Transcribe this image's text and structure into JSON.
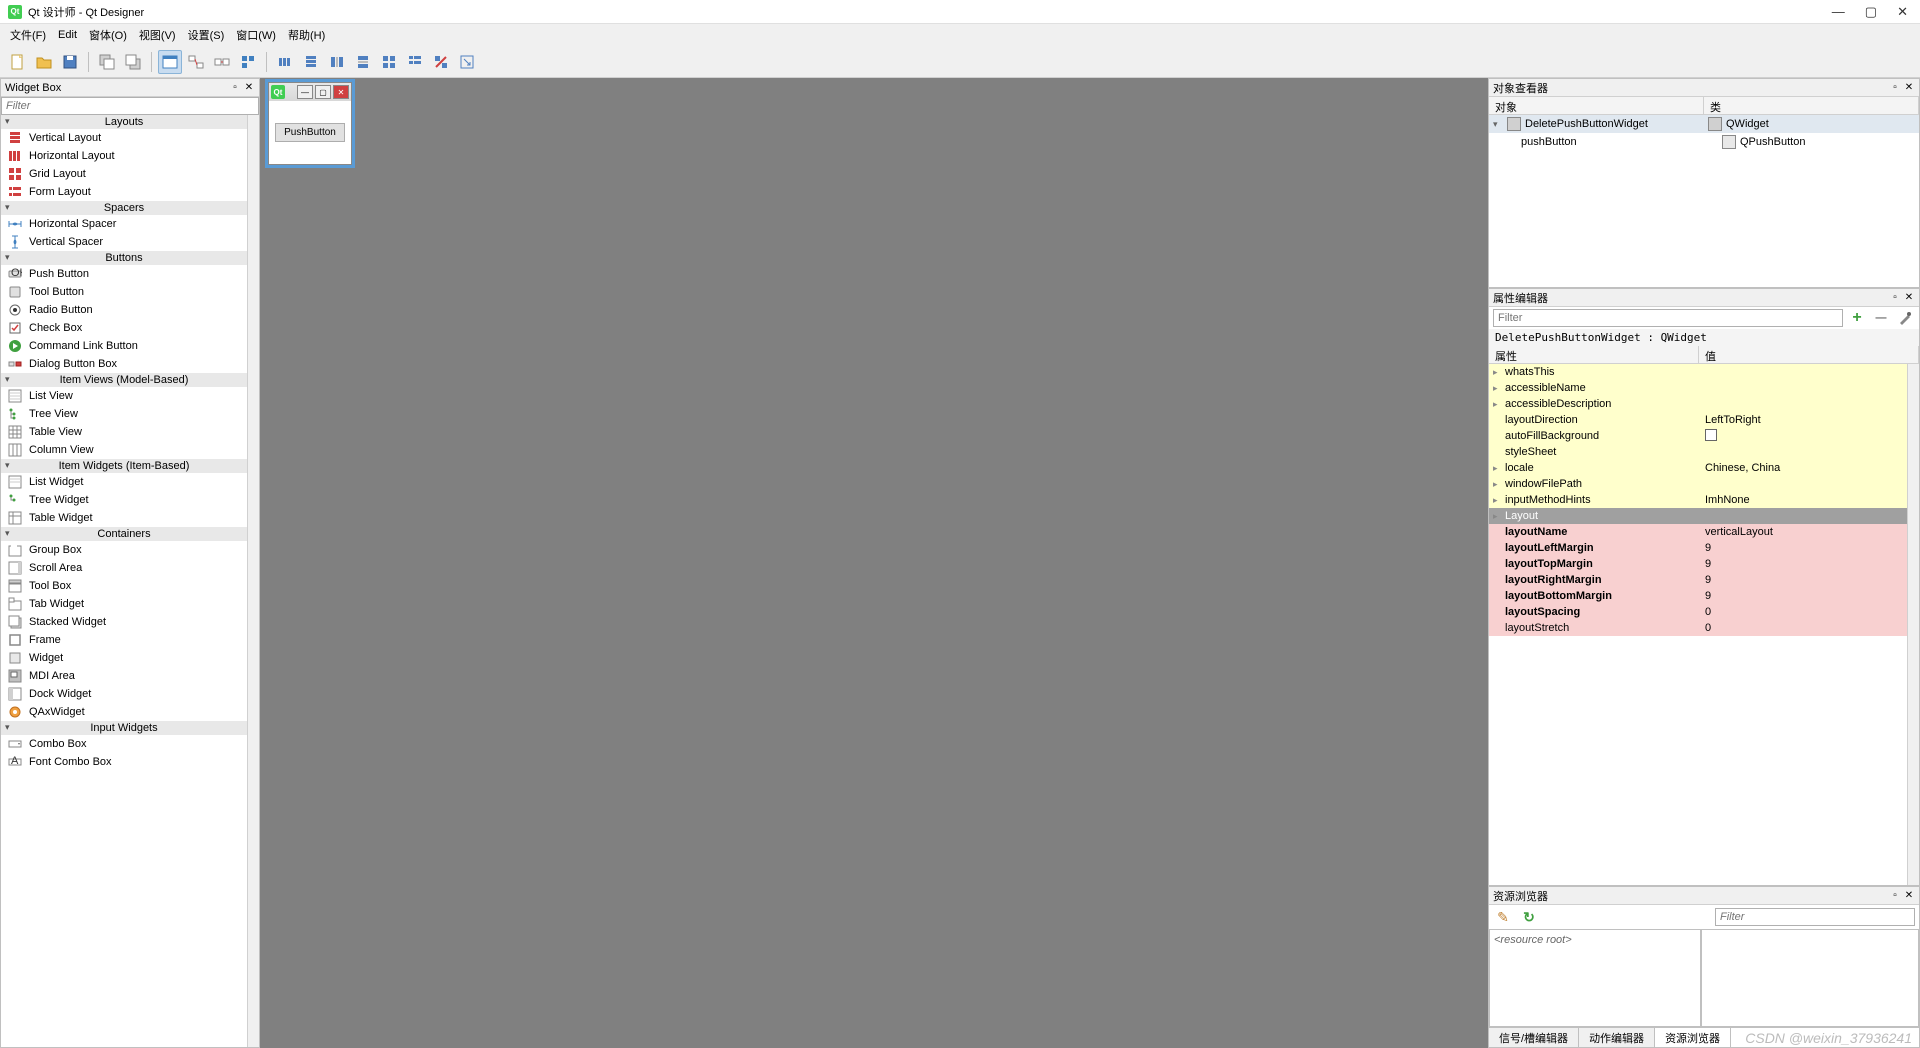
{
  "app": {
    "title": "Qt 设计师 - Qt Designer"
  },
  "menu": {
    "file": "文件(F)",
    "edit": "Edit",
    "form": "窗体(O)",
    "view": "视图(V)",
    "settings": "设置(S)",
    "window": "窗口(W)",
    "help": "帮助(H)"
  },
  "widgetBox": {
    "title": "Widget Box",
    "filterPlaceholder": "Filter",
    "categories": {
      "layouts": "Layouts",
      "spacers": "Spacers",
      "buttons": "Buttons",
      "itemViews": "Item Views (Model-Based)",
      "itemWidgets": "Item Widgets (Item-Based)",
      "containers": "Containers",
      "inputWidgets": "Input Widgets"
    },
    "items": {
      "verticalLayout": "Vertical Layout",
      "horizontalLayout": "Horizontal Layout",
      "gridLayout": "Grid Layout",
      "formLayout": "Form Layout",
      "horizontalSpacer": "Horizontal Spacer",
      "verticalSpacer": "Vertical Spacer",
      "pushButton": "Push Button",
      "toolButton": "Tool Button",
      "radioButton": "Radio Button",
      "checkBox": "Check Box",
      "commandLinkButton": "Command Link Button",
      "dialogButtonBox": "Dialog Button Box",
      "listView": "List View",
      "treeView": "Tree View",
      "tableView": "Table View",
      "columnView": "Column View",
      "listWidget": "List Widget",
      "treeWidget": "Tree Widget",
      "tableWidget": "Table Widget",
      "groupBox": "Group Box",
      "scrollArea": "Scroll Area",
      "toolBox": "Tool Box",
      "tabWidget": "Tab Widget",
      "stackedWidget": "Stacked Widget",
      "frame": "Frame",
      "widget": "Widget",
      "mdiArea": "MDI Area",
      "dockWidget": "Dock Widget",
      "qaxWidget": "QAxWidget",
      "comboBox": "Combo Box",
      "fontComboBox": "Font Combo Box"
    }
  },
  "form": {
    "buttonText": "PushButton"
  },
  "objectInspector": {
    "title": "对象查看器",
    "colObject": "对象",
    "colClass": "类",
    "rows": [
      {
        "name": "DeletePushButtonWidget",
        "class": "QWidget",
        "indent": 0,
        "expandable": true
      },
      {
        "name": "pushButton",
        "class": "QPushButton",
        "indent": 1,
        "expandable": false
      }
    ]
  },
  "propertyEditor": {
    "title": "属性编辑器",
    "filterPlaceholder": "Filter",
    "context": "DeletePushButtonWidget : QWidget",
    "colProp": "属性",
    "colValue": "值",
    "rows": [
      {
        "name": "whatsThis",
        "value": "",
        "style": "yellow",
        "exp": true
      },
      {
        "name": "accessibleName",
        "value": "",
        "style": "yellow",
        "exp": true
      },
      {
        "name": "accessibleDescription",
        "value": "",
        "style": "yellow",
        "exp": true
      },
      {
        "name": "layoutDirection",
        "value": "LeftToRight",
        "style": "yellow"
      },
      {
        "name": "autoFillBackground",
        "value": "checkbox",
        "style": "yellow"
      },
      {
        "name": "styleSheet",
        "value": "",
        "style": "yellow"
      },
      {
        "name": "locale",
        "value": "Chinese, China",
        "style": "yellow",
        "exp": true
      },
      {
        "name": "windowFilePath",
        "value": "",
        "style": "yellow",
        "exp": true
      },
      {
        "name": "inputMethodHints",
        "value": "ImhNone",
        "style": "yellow",
        "exp": true
      },
      {
        "name": "Layout",
        "value": "",
        "style": "gray",
        "exp": true
      },
      {
        "name": "layoutName",
        "value": "verticalLayout",
        "style": "pink",
        "bold": true
      },
      {
        "name": "layoutLeftMargin",
        "value": "9",
        "style": "pink",
        "bold": true
      },
      {
        "name": "layoutTopMargin",
        "value": "9",
        "style": "pink",
        "bold": true
      },
      {
        "name": "layoutRightMargin",
        "value": "9",
        "style": "pink",
        "bold": true
      },
      {
        "name": "layoutBottomMargin",
        "value": "9",
        "style": "pink",
        "bold": true
      },
      {
        "name": "layoutSpacing",
        "value": "0",
        "style": "pink",
        "bold": true
      },
      {
        "name": "layoutStretch",
        "value": "0",
        "style": "pink"
      }
    ]
  },
  "resourceBrowser": {
    "title": "资源浏览器",
    "filterPlaceholder": "Filter",
    "root": "<resource root>",
    "tabs": {
      "signalSlot": "信号/槽编辑器",
      "action": "动作编辑器",
      "resource": "资源浏览器"
    }
  },
  "watermark": "CSDN @weixin_37936241"
}
